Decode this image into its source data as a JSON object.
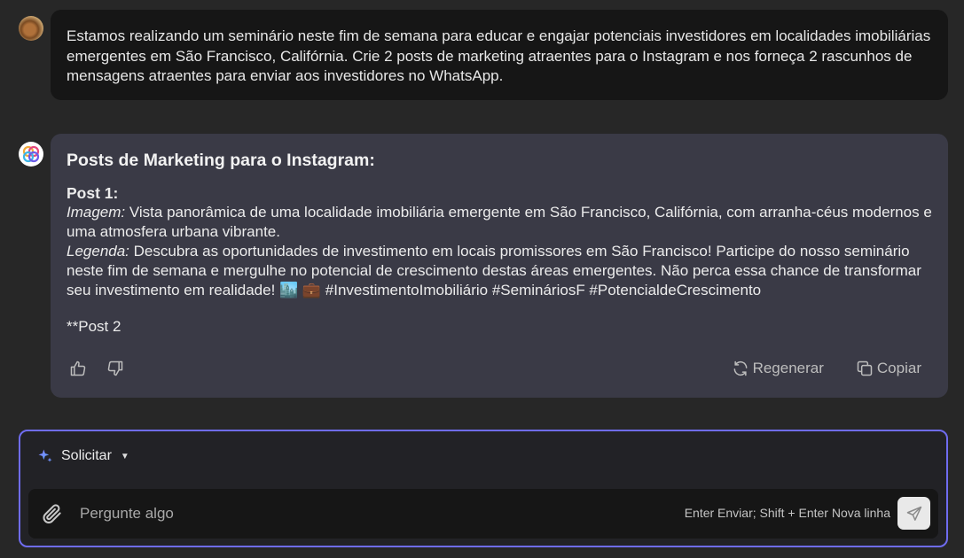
{
  "user_message": {
    "text": "Estamos realizando um seminário neste fim de semana para educar e engajar potenciais investidores em localidades imobiliárias emergentes em São Francisco, Califórnia. Crie 2 posts de marketing atraentes para o Instagram e nos forneça 2 rascunhos de mensagens atraentes para enviar aos investidores no WhatsApp."
  },
  "bot_message": {
    "heading": "Posts de Marketing para o Instagram:",
    "post1_title": "Post 1:",
    "image_label": "Imagem:",
    "image_text": " Vista panorâmica de uma localidade imobiliária emergente em São Francisco, Califórnia, com arranha-céus modernos e uma atmosfera urbana vibrante.",
    "caption_label": "Legenda:",
    "caption_text": " Descubra as oportunidades de investimento em locais promissores em São Francisco! Participe do nosso seminário neste fim de semana e mergulhe no potencial de crescimento destas áreas emergentes. Não perca essa chance de transformar seu investimento em realidade! 🏙️ 💼 #InvestimentoImobiliário #SemináriosF #PotencialdeCrescimento",
    "post2_partial": "**Post 2"
  },
  "actions": {
    "regenerate_label": "Regenerar",
    "copy_label": "Copiar"
  },
  "composer": {
    "prompt_label": "Solicitar",
    "input_placeholder": "Pergunte algo",
    "hint": "Enter Enviar; Shift + Enter Nova linha"
  },
  "colors": {
    "accent_border": "#6f6cf0",
    "bot_bubble": "#3a3a46",
    "user_bubble": "#161616",
    "background": "#272727"
  },
  "icons": {
    "like": "thumbs-up-icon",
    "dislike": "thumbs-down-icon",
    "regenerate": "refresh-icon",
    "copy": "copy-icon",
    "sparkle": "sparkle-icon",
    "attach": "paperclip-icon",
    "send": "send-icon"
  }
}
